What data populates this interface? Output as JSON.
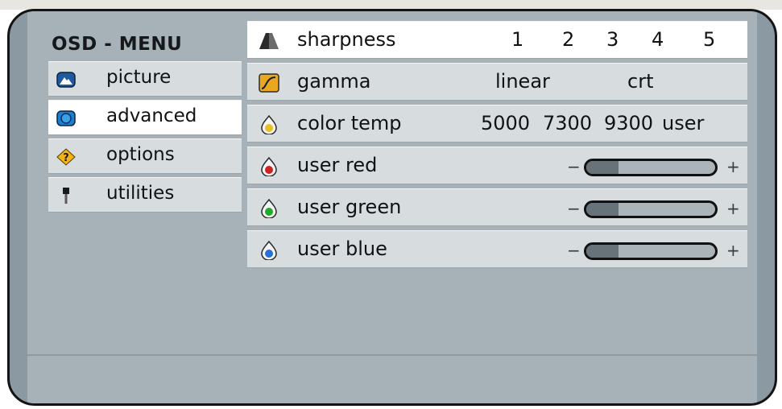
{
  "menu": {
    "title": "OSD - MENU"
  },
  "sidebar": {
    "items": [
      {
        "label": "picture",
        "icon": "picture-icon",
        "active": false
      },
      {
        "label": "advanced",
        "icon": "advanced-icon",
        "active": true
      },
      {
        "label": "options",
        "icon": "question-icon",
        "active": false
      },
      {
        "label": "utilities",
        "icon": "tool-icon",
        "active": false
      }
    ]
  },
  "rows": {
    "sharpness": {
      "label": "sharpness",
      "options": [
        "1",
        "2",
        "3",
        "4",
        "5"
      ]
    },
    "gamma": {
      "label": "gamma",
      "options": [
        "linear",
        "crt"
      ]
    },
    "color_temp": {
      "label": "color temp",
      "options": [
        "5000",
        "7300",
        "9300",
        "user"
      ]
    },
    "user_red": {
      "label": "user red",
      "minus": "−",
      "plus": "+",
      "level": 0.25
    },
    "user_green": {
      "label": "user green",
      "minus": "−",
      "plus": "+",
      "level": 0.25
    },
    "user_blue": {
      "label": "user blue",
      "minus": "−",
      "plus": "+",
      "level": 0.25
    }
  },
  "colors": {
    "frame": "#8b9aa2",
    "panel": "#a6b2b8",
    "row": "#d7dcdf",
    "selected": "#ffffff",
    "red_drop": "#d02020",
    "green_drop": "#1faa2a",
    "blue_drop": "#2a6fd8",
    "yellow_drop": "#e8c020"
  }
}
